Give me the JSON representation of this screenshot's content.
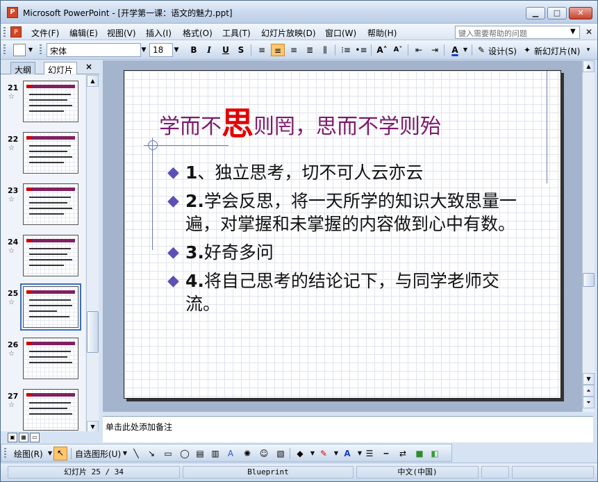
{
  "window": {
    "title": "Microsoft PowerPoint - [开学第一课：语文的魅力.ppt]",
    "app_icon": "powerpoint-icon",
    "minimize": "minimize-icon",
    "maximize": "maximize-icon",
    "close": "close-icon"
  },
  "menubar": {
    "items": [
      "文件(F)",
      "编辑(E)",
      "视图(V)",
      "插入(I)",
      "格式(O)",
      "工具(T)",
      "幻灯片放映(D)",
      "窗口(W)",
      "帮助(H)"
    ],
    "help_placeholder": "键入需要帮助的问题"
  },
  "toolbar": {
    "font_name": "宋体",
    "font_size": "18",
    "bold": "B",
    "italic": "I",
    "underline": "U",
    "shadow": "S",
    "font_color_letter": "A",
    "design_label": "设计(S)",
    "new_slide_label": "新幻灯片(N)"
  },
  "left_pane": {
    "tabs": [
      "大纲",
      "幻灯片"
    ],
    "close": "×",
    "thumbnails": [
      "21",
      "22",
      "23",
      "24",
      "25",
      "26",
      "27"
    ],
    "selected": "25"
  },
  "slide": {
    "title_before": "学而不",
    "title_highlight": "思",
    "title_after": "则罔，思而不学则殆",
    "bullets": [
      {
        "num": "1",
        "text": "、独立思考，切不可人云亦云"
      },
      {
        "num": "2.",
        "text": "学会反思，将一天所学的知识大致思量一遍，对掌握和未掌握的内容做到心中有数。"
      },
      {
        "num": "3.",
        "text": "好奇多问"
      },
      {
        "num": "4.",
        "text": "将自己思考的结论记下，与同学老师交流。"
      }
    ],
    "colors": {
      "title": "#7b1a6b",
      "highlight": "#e30000",
      "bullet_mark": "#5c4fb5"
    }
  },
  "notes": {
    "placeholder": "单击此处添加备注"
  },
  "drawbar": {
    "draw_label": "绘图(R)",
    "autoshapes_label": "自选图形(U)"
  },
  "status": {
    "slide_info": "幻灯片 25 / 34",
    "template": "Blueprint",
    "language": "中文(中国)"
  }
}
